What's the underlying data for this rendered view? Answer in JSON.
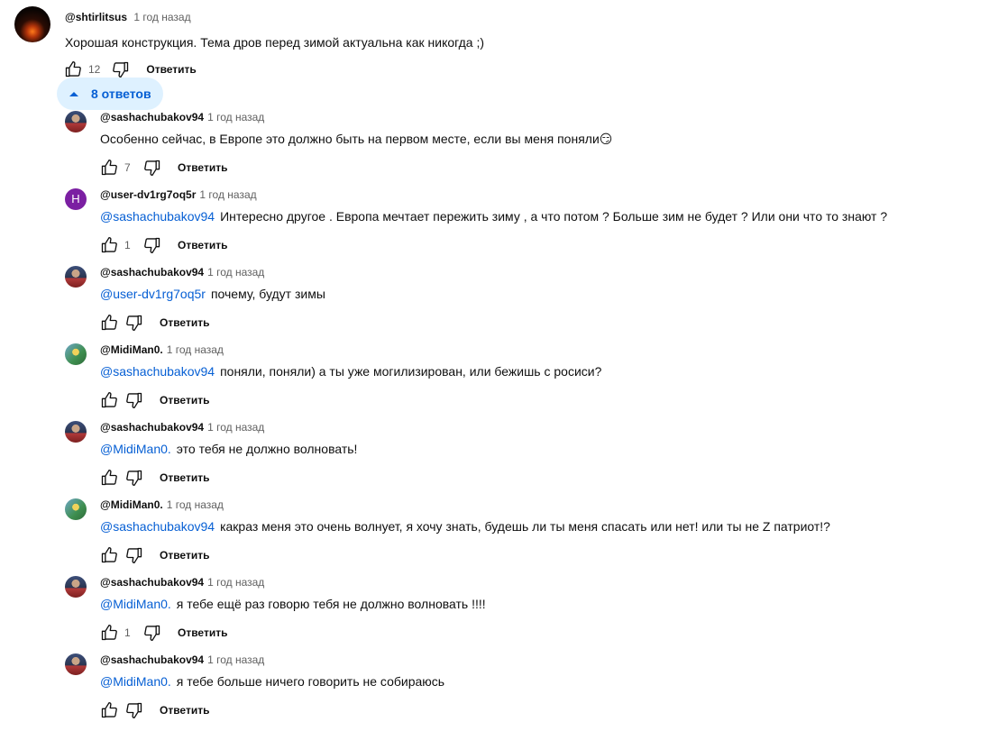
{
  "top_comment": {
    "author": "@shtirlitsus",
    "time": "1 год назад",
    "text": "Хорошая конструкция. Тема дров перед зимой актуальна как никогда ;)",
    "likes": "12",
    "reply_label": "Ответить"
  },
  "replies_toggle": {
    "label": "8 ответов"
  },
  "replies": [
    {
      "author": "@sashachubakov94",
      "time": "1 год назад",
      "mention": "",
      "text": "Особенно сейчас, в Европе это должно быть на первом месте, если вы меня поняли😏",
      "likes": "7",
      "reply_label": "Ответить",
      "avatar": "sasha"
    },
    {
      "author": "@user-dv1rg7oq5r",
      "time": "1 год назад",
      "mention": "@sashachubakov94",
      "text": "Интересно другое . Европа мечтает пережить зиму , а что потом ? Больше зим не будет ? Или они что то знают ?",
      "likes": "1",
      "reply_label": "Ответить",
      "avatar": "user",
      "avatar_letter": "Н"
    },
    {
      "author": "@sashachubakov94",
      "time": "1 год назад",
      "mention": "@user-dv1rg7oq5r",
      "text": "почему, будут зимы",
      "likes": "",
      "reply_label": "Ответить",
      "avatar": "sasha"
    },
    {
      "author": "@MidiMan0.",
      "time": "1 год назад",
      "mention": "@sashachubakov94",
      "text": "поняли, поняли) а ты уже могилизирован, или бежишь с росиси?",
      "likes": "",
      "reply_label": "Ответить",
      "avatar": "midi"
    },
    {
      "author": "@sashachubakov94",
      "time": "1 год назад",
      "mention": "@MidiMan0.",
      "text": "это тебя не должно волновать!",
      "likes": "",
      "reply_label": "Ответить",
      "avatar": "sasha"
    },
    {
      "author": "@MidiMan0.",
      "time": "1 год назад",
      "mention": "@sashachubakov94",
      "text": "какраз меня это очень волнует, я хочу знать, будешь ли ты меня спасать или нет! или ты не Z патриот!?",
      "likes": "",
      "reply_label": "Ответить",
      "avatar": "midi"
    },
    {
      "author": "@sashachubakov94",
      "time": "1 год назад",
      "mention": "@MidiMan0.",
      "text": "я тебе ещё раз говорю тебя не должно волновать !!!!",
      "likes": "1",
      "reply_label": "Ответить",
      "avatar": "sasha"
    },
    {
      "author": "@sashachubakov94",
      "time": "1 год назад",
      "mention": "@MidiMan0.",
      "text": "я тебе больше ничего говорить не собираюсь",
      "likes": "",
      "reply_label": "Ответить",
      "avatar": "sasha"
    }
  ]
}
